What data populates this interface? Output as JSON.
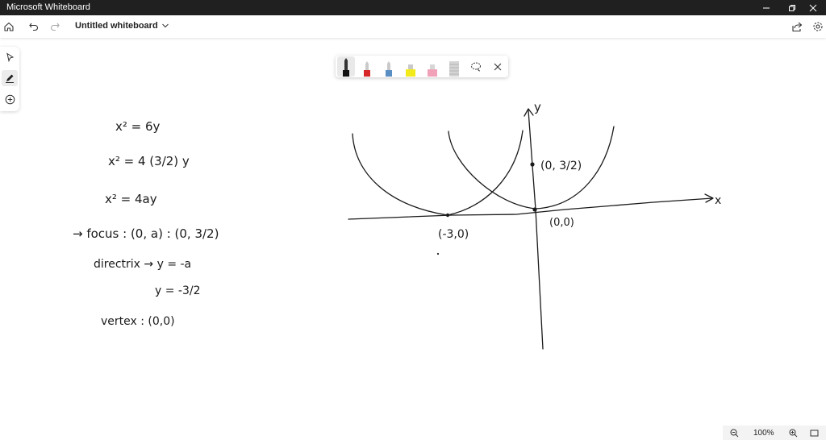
{
  "window": {
    "app_title": "Microsoft Whiteboard"
  },
  "topbar": {
    "board_title": "Untitled whiteboard"
  },
  "icons": {
    "home": "home-icon",
    "undo": "undo-icon",
    "redo": "redo-icon",
    "share": "share-icon",
    "settings": "gear-icon",
    "select": "select-cursor-icon",
    "ink": "pen-icon",
    "add": "plus-circle-icon",
    "lasso": "lasso-icon",
    "close": "close-icon",
    "zoom_out": "zoom-out-icon",
    "zoom_in": "zoom-in-icon",
    "fit": "fit-screen-icon"
  },
  "pens": [
    {
      "name": "black-pen",
      "color": "#1a1a1a"
    },
    {
      "name": "red-pen",
      "color": "#d62828"
    },
    {
      "name": "blue-pen",
      "color": "#5a8fc4"
    },
    {
      "name": "yellow-highlighter",
      "color": "#f2ea1a"
    },
    {
      "name": "pink-highlighter",
      "color": "#f2a2b8"
    },
    {
      "name": "eraser",
      "color": "#c8c8c8"
    }
  ],
  "zoom": {
    "level": "100%"
  },
  "whiteboard": {
    "equation_lines": {
      "line1": "x² = 6y",
      "line2": "x² = 4 (3/2) y",
      "line3": "x² = 4ay",
      "focus": "→ focus : (0, a) : (0, 3/2)",
      "directrix_a": "directrix → y = -a",
      "directrix_b": "y = -3/2",
      "vertex": "vertex : (0,0)"
    },
    "graph_labels": {
      "x_axis": "x",
      "y_axis": "y",
      "focus_point": "(0, 3/2)",
      "origin": "(0,0)",
      "shifted_vertex": "(-3,0)"
    }
  }
}
